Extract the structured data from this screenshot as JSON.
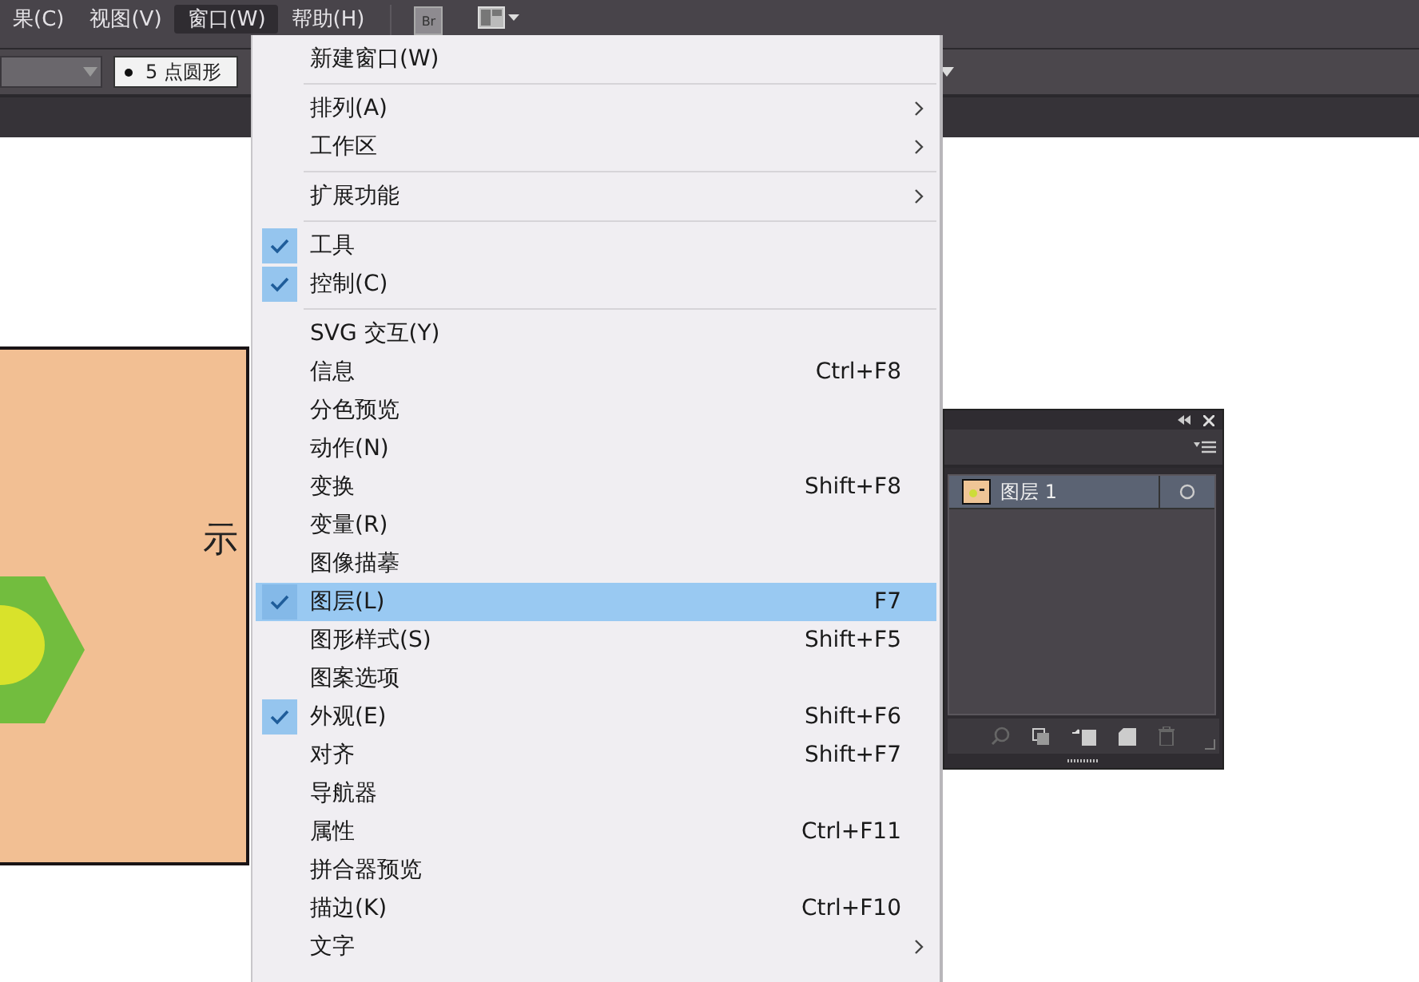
{
  "menubar": {
    "items": [
      {
        "label": "果(C)",
        "selected": false
      },
      {
        "label": "视图(V)",
        "selected": false
      },
      {
        "label": "窗口(W)",
        "selected": true
      },
      {
        "label": "帮助(H)",
        "selected": false
      }
    ],
    "bridge_label": "Br"
  },
  "control_bar": {
    "stroke_profile": "5 点圆形"
  },
  "menu": {
    "items": [
      {
        "kind": "item",
        "label": "新建窗口(W)",
        "checked": false,
        "selected": false
      },
      {
        "kind": "separator"
      },
      {
        "kind": "item",
        "label": "排列(A)",
        "checked": false,
        "selected": false,
        "submenu": true
      },
      {
        "kind": "item",
        "label": "工作区",
        "checked": false,
        "selected": false,
        "submenu": true
      },
      {
        "kind": "separator"
      },
      {
        "kind": "item",
        "label": "扩展功能",
        "checked": false,
        "selected": false,
        "submenu": true
      },
      {
        "kind": "separator"
      },
      {
        "kind": "item",
        "label": "工具",
        "checked": true,
        "selected": false
      },
      {
        "kind": "item",
        "label": "控制(C)",
        "checked": true,
        "selected": false
      },
      {
        "kind": "separator"
      },
      {
        "kind": "item",
        "label": "SVG 交互(Y)",
        "checked": false,
        "selected": false
      },
      {
        "kind": "item",
        "label": "信息",
        "checked": false,
        "selected": false,
        "shortcut": "Ctrl+F8"
      },
      {
        "kind": "item",
        "label": "分色预览",
        "checked": false,
        "selected": false
      },
      {
        "kind": "item",
        "label": "动作(N)",
        "checked": false,
        "selected": false
      },
      {
        "kind": "item",
        "label": "变换",
        "checked": false,
        "selected": false,
        "shortcut": "Shift+F8"
      },
      {
        "kind": "item",
        "label": "变量(R)",
        "checked": false,
        "selected": false
      },
      {
        "kind": "item",
        "label": "图像描摹",
        "checked": false,
        "selected": false
      },
      {
        "kind": "item",
        "label": "图层(L)",
        "checked": true,
        "selected": true,
        "shortcut": "F7"
      },
      {
        "kind": "item",
        "label": "图形样式(S)",
        "checked": false,
        "selected": false,
        "shortcut": "Shift+F5"
      },
      {
        "kind": "item",
        "label": "图案选项",
        "checked": false,
        "selected": false
      },
      {
        "kind": "item",
        "label": "外观(E)",
        "checked": true,
        "selected": false,
        "shortcut": "Shift+F6"
      },
      {
        "kind": "item",
        "label": "对齐",
        "checked": false,
        "selected": false,
        "shortcut": "Shift+F7"
      },
      {
        "kind": "item",
        "label": "导航器",
        "checked": false,
        "selected": false
      },
      {
        "kind": "item",
        "label": "属性",
        "checked": false,
        "selected": false,
        "shortcut": "Ctrl+F11"
      },
      {
        "kind": "item",
        "label": "拼合器预览",
        "checked": false,
        "selected": false
      },
      {
        "kind": "item",
        "label": "描边(K)",
        "checked": false,
        "selected": false,
        "shortcut": "Ctrl+F10"
      },
      {
        "kind": "item",
        "label": "文字",
        "checked": false,
        "selected": false,
        "submenu": true
      }
    ]
  },
  "artboard": {
    "text": "示"
  },
  "layers_panel": {
    "layers": [
      {
        "name": "图层 1",
        "selected": true
      }
    ]
  }
}
